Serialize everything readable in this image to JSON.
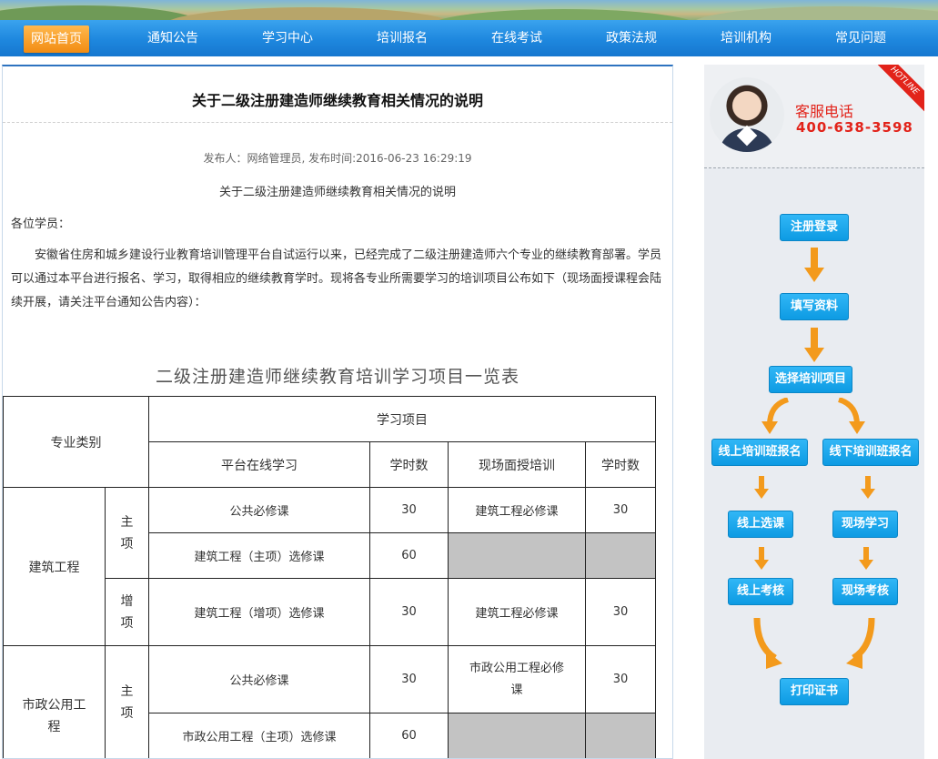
{
  "nav": {
    "items": [
      "网站首页",
      "通知公告",
      "学习中心",
      "培训报名",
      "在线考试",
      "政策法规",
      "培训机构",
      "常见问题"
    ]
  },
  "article": {
    "title": "关于二级注册建造师继续教育相关情况的说明",
    "meta": "发布人：网络管理员,   发布时间:2016-06-23 16:29:19",
    "subtitle": "关于二级注册建造师继续教育相关情况的说明",
    "greeting": "各位学员：",
    "paragraph": "安徽省住房和城乡建设行业教育培训管理平台自试运行以来，已经完成了二级注册建造师六个专业的继续教育部署。学员可以通过本平台进行报名、学习，取得相应的继续教育学时。现将各专业所需要学习的培训项目公布如下（现场面授课程会陆续开展，请关注平台通知公告内容）：",
    "table_title": "二级注册建造师继续教育培训学习项目一览表"
  },
  "table": {
    "header_category": "专业类别",
    "header_project": "学习项目",
    "header_online": "平台在线学习",
    "header_hours1": "学时数",
    "header_onsite": "现场面授培训",
    "header_hours2": "学时数",
    "rows": {
      "construction": "建筑工程",
      "main1": "主项",
      "add1": "增项",
      "r1_online": "公共必修课",
      "r1_hours": "30",
      "r1_onsite": "建筑工程必修课",
      "r1_hours2": "30",
      "r2_online": "建筑工程（主项）选修课",
      "r2_hours": "60",
      "r3_online": "建筑工程（增项）选修课",
      "r3_hours": "30",
      "r3_onsite": "建筑工程必修课",
      "r3_hours2": "30",
      "municipal": "市政公用工程",
      "main2": "主项",
      "r4_online": "公共必修课",
      "r4_hours": "30",
      "r4_onsite": "市政公用工程必修课",
      "r4_hours2": "30",
      "r5_online": "市政公用工程（主项）选修课",
      "r5_hours": "60"
    }
  },
  "sidebar": {
    "ribbon": "HOTLINE",
    "phone_label": "客服电话",
    "phone_number": "400-638-3598",
    "flow": {
      "register": "注册登录",
      "fill_info": "填写资料",
      "select_project": "选择培训项目",
      "online_signup": "线上培训班报名",
      "offline_signup": "线下培训班报名",
      "online_course": "线上选课",
      "onsite_study": "现场学习",
      "online_exam": "线上考核",
      "onsite_exam": "现场考核",
      "print_cert": "打印证书"
    }
  }
}
